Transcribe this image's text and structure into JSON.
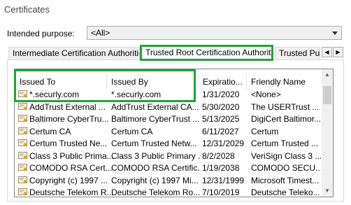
{
  "window": {
    "title": "Certificates"
  },
  "purpose": {
    "label": "Intended purpose:",
    "value": "<All>"
  },
  "tabs": [
    {
      "label": "Intermediate Certification Authorities"
    },
    {
      "label": "Trusted Root Certification Authorities"
    },
    {
      "label": "Trusted Publ"
    }
  ],
  "columns": [
    "Issued To",
    "Issued By",
    "Expiratio...",
    "Friendly Name"
  ],
  "rows": [
    {
      "issued_to": "*.securly.com",
      "issued_by": "*.securly.com",
      "expiration": "1/31/2020",
      "friendly": "<None>"
    },
    {
      "issued_to": "AddTrust External ...",
      "issued_by": "AddTrust External CA...",
      "expiration": "5/30/2020",
      "friendly": "The USERTrust ..."
    },
    {
      "issued_to": "Baltimore CyberTru...",
      "issued_by": "Baltimore CyberTrust ...",
      "expiration": "5/13/2025",
      "friendly": "DigiCert Baltimor..."
    },
    {
      "issued_to": "Certum CA",
      "issued_by": "Certum CA",
      "expiration": "6/11/2027",
      "friendly": "Certum"
    },
    {
      "issued_to": "Certum Trusted Ne...",
      "issued_by": "Certum Trusted Netw...",
      "expiration": "12/31/2029",
      "friendly": "Certum Trusted ..."
    },
    {
      "issued_to": "Class 3 Public Prima...",
      "issued_by": "Class 3 Public Primary ...",
      "expiration": "8/2/2028",
      "friendly": "VeriSign Class 3 ..."
    },
    {
      "issued_to": "COMODO RSA Cert...",
      "issued_by": "COMODO RSA Certific...",
      "expiration": "1/19/2038",
      "friendly": "COMODO SECU..."
    },
    {
      "issued_to": "Copyright (c) 1997 ...",
      "issued_by": "Copyright (c) 1997 Mi...",
      "expiration": "12/31/1999",
      "friendly": "Microsoft Timest..."
    },
    {
      "issued_to": "Deutsche Telekom R...",
      "issued_by": "Deutsche Telekom Ro...",
      "expiration": "7/10/2019",
      "friendly": "Deutsche Teleko..."
    }
  ],
  "colors": {
    "highlight": "#21a336",
    "cert_ribbon": "#e6a817"
  },
  "icons": {
    "row": "certificate-icon",
    "scroll_up": "chevron-up-icon",
    "scroll_down": "chevron-down-icon"
  }
}
